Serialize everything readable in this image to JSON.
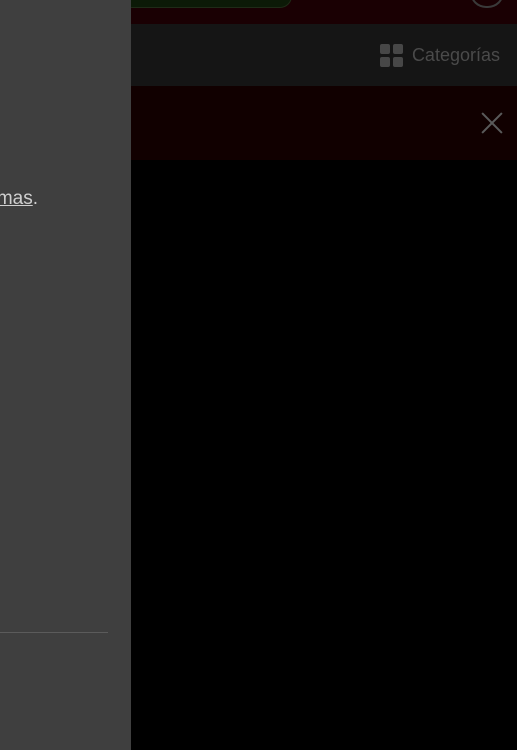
{
  "header": {
    "categories_label": "Categorías",
    "categories_icon": "grid-icon",
    "close_icon": "close-icon"
  },
  "drawer": {
    "link_text": "mas",
    "trailing_text": "."
  },
  "colors": {
    "background": "#000000",
    "drawer_background": "#3f3f3f",
    "nav_background": "#151515",
    "banner_background": "#110000"
  }
}
